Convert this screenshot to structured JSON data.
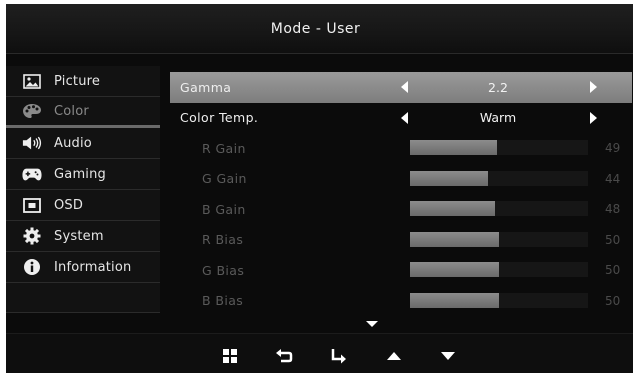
{
  "window": {
    "title": "Mode - User"
  },
  "sidebar": {
    "items": [
      {
        "label": "Picture",
        "icon": "picture-icon",
        "active": false
      },
      {
        "label": "Color",
        "icon": "palette-icon",
        "active": true
      },
      {
        "label": "Audio",
        "icon": "speaker-icon",
        "active": false
      },
      {
        "label": "Gaming",
        "icon": "gamepad-icon",
        "active": false
      },
      {
        "label": "OSD",
        "icon": "osd-icon",
        "active": false
      },
      {
        "label": "System",
        "icon": "gear-icon",
        "active": false
      },
      {
        "label": "Information",
        "icon": "info-icon",
        "active": false
      }
    ]
  },
  "settings": {
    "gamma": {
      "label": "Gamma",
      "value": "2.2"
    },
    "color_temp": {
      "label": "Color  Temp.",
      "value": "Warm"
    },
    "sliders": [
      {
        "label": "R  Gain",
        "value": "49",
        "fraction": 0.49
      },
      {
        "label": "G  Gain",
        "value": "44",
        "fraction": 0.44
      },
      {
        "label": "B  Gain",
        "value": "48",
        "fraction": 0.48
      },
      {
        "label": "R  Bias",
        "value": "50",
        "fraction": 0.5
      },
      {
        "label": "G  Bias",
        "value": "50",
        "fraction": 0.5
      },
      {
        "label": "B  Bias",
        "value": "50",
        "fraction": 0.5
      }
    ]
  },
  "navigation": {
    "buttons": [
      "menu-icon",
      "back-icon",
      "enter-icon",
      "up-arrow-icon",
      "down-arrow-icon"
    ]
  },
  "colors": {
    "background": "#0b0b0b",
    "highlight": "#8c8c8c",
    "text": "#e6e6e6",
    "dim_text": "#5a5a5a"
  }
}
